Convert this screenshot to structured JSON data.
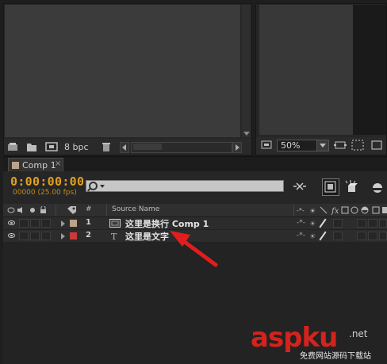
{
  "project_panel": {
    "bpc_label": "8 bpc"
  },
  "comp_viewer": {
    "zoom_value": "50%"
  },
  "timeline": {
    "tab_label": "Comp 1",
    "tab_close": "×",
    "timecode": "0:00:00:00",
    "fps_label": "00000 (25.00 fps)",
    "columns": {
      "hash": "#",
      "source_name": "Source Name"
    },
    "layers": [
      {
        "number": "1",
        "name": "这里是换行 Comp 1",
        "label_color": "#b9a58a",
        "type_icon": "comp-icon"
      },
      {
        "number": "2",
        "name": "这里是文字",
        "label_color": "#c93a3a",
        "type_icon": "text-layer-icon"
      }
    ]
  },
  "watermark": {
    "brand": "aspku",
    "suffix": ".net",
    "subtitle": "免费网站源码下载站"
  },
  "colors": {
    "timecode": "#e0a020",
    "annotation_arrow": "#e21d1d"
  }
}
